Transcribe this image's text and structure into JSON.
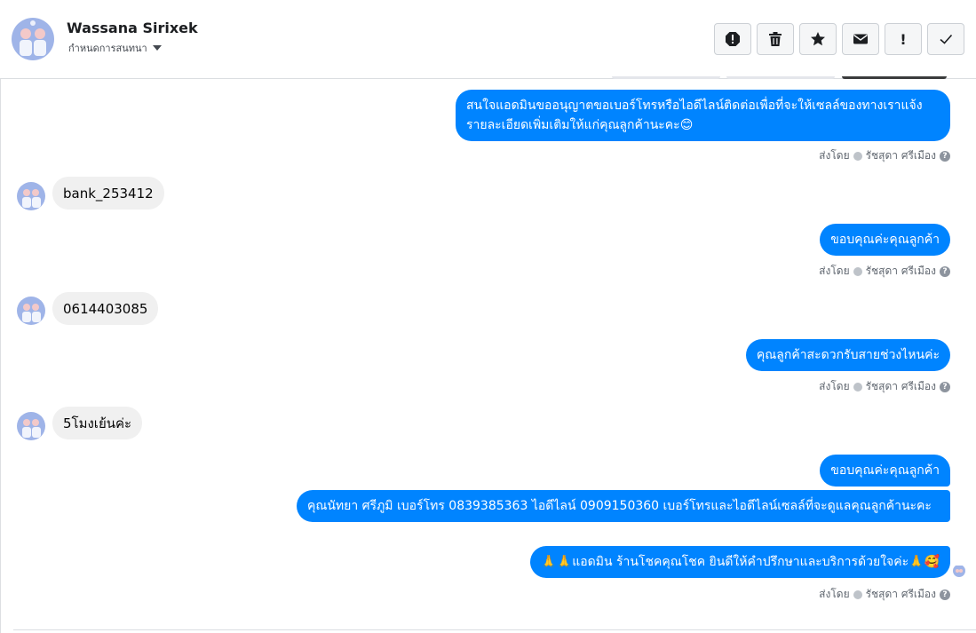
{
  "header": {
    "name": "Wassana Sirixek",
    "subtitle": "กำหนดการสนทนา"
  },
  "toolbar": {
    "alert_label": "!"
  },
  "messages": {
    "m1": "สนใจแอดมินขออนุญาตขอเบอร์โทรหรือไอดีไลน์ติดต่อเพื่อที่จะให้เซลล์ของทางเราแจ้งรายละเอียดเพิ่มเติมให้แก่คุณลูกค้านะคะ😊",
    "m2": "bank_253412",
    "m3": "ขอบคุณค่ะคุณลูกค้า",
    "m4": "0614403085",
    "m5": "คุณลูกค้าสะดวกรับสายช่วงไหนค่ะ",
    "m6": "5โมงเย้นค่ะ",
    "m7": "ขอบคุณค่ะคุณลูกค้า",
    "m8": "คุณนัทยา ศรีภูมิ      เบอร์โทร 0839385363  ไอดีไลน์ 0909150360   เบอร์โทรและไอดีไลน์เซลล์ที่จะดูแลคุณลูกค้านะคะ",
    "m9": "🙏🙏แอดมิน ร้านโชคคุณโชค ยินดีให้คำปรึกษาและบริการด้วยใจค่ะ🙏🥰"
  },
  "sent_by": {
    "prefix": "ส่งโดย",
    "agent": "รัชสุดา ศรีเมือง"
  },
  "colors": {
    "outgoing_bubble": "#0084ff",
    "incoming_bubble": "#f0f0f0"
  },
  "icons": {
    "toolbar": [
      "spam-icon",
      "trash-icon",
      "star-icon",
      "envelope-icon",
      "exclamation-icon",
      "check-icon"
    ]
  }
}
